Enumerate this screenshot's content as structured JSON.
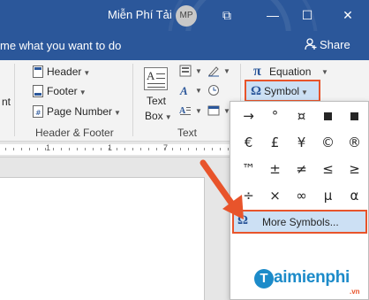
{
  "window": {
    "title": "Miễn Phí Tải",
    "avatar_initials": "MP",
    "restore_glyph": "⧉",
    "minimize_glyph": "—",
    "maximize_glyph": "☐",
    "close_glyph": "✕"
  },
  "tellbar": {
    "tell_me_text": "me what you want to do",
    "share_label": "Share"
  },
  "ribbon": {
    "left_cut_text": "nt",
    "header_footer_group": {
      "label": "Header & Footer",
      "items": [
        {
          "label": "Header",
          "icon": "header-icon"
        },
        {
          "label": "Footer",
          "icon": "footer-icon"
        },
        {
          "label": "Page Number",
          "icon": "page-number-icon"
        }
      ]
    },
    "text_group": {
      "label": "Text",
      "textbox_label_line1": "Text",
      "textbox_label_line2": "Box"
    },
    "symbols_group": {
      "equation_label": "Equation",
      "symbol_label": "Symbol",
      "pi_glyph": "π",
      "omega_glyph": "Ω"
    }
  },
  "ruler": {
    "markers": [
      "1",
      "1",
      "7"
    ]
  },
  "symbol_panel": {
    "symbols": [
      [
        "→",
        "°",
        "¤",
        "■",
        "■"
      ],
      [
        "€",
        "£",
        "¥",
        "©",
        "®"
      ],
      [
        "™",
        "±",
        "≠",
        "≤",
        "≥"
      ],
      [
        "÷",
        "×",
        "∞",
        "µ",
        "α"
      ]
    ],
    "more_symbols_label": "More Symbols...",
    "more_symbols_omega": "Ω"
  },
  "watermark": {
    "badge": "T",
    "brand": "aimienphi",
    "tld": ".vn"
  },
  "colors": {
    "title_blue": "#2b579a",
    "highlight_border": "#e8542b",
    "highlight_fill": "#cce0f4",
    "watermark_blue": "#1c8bc9"
  }
}
